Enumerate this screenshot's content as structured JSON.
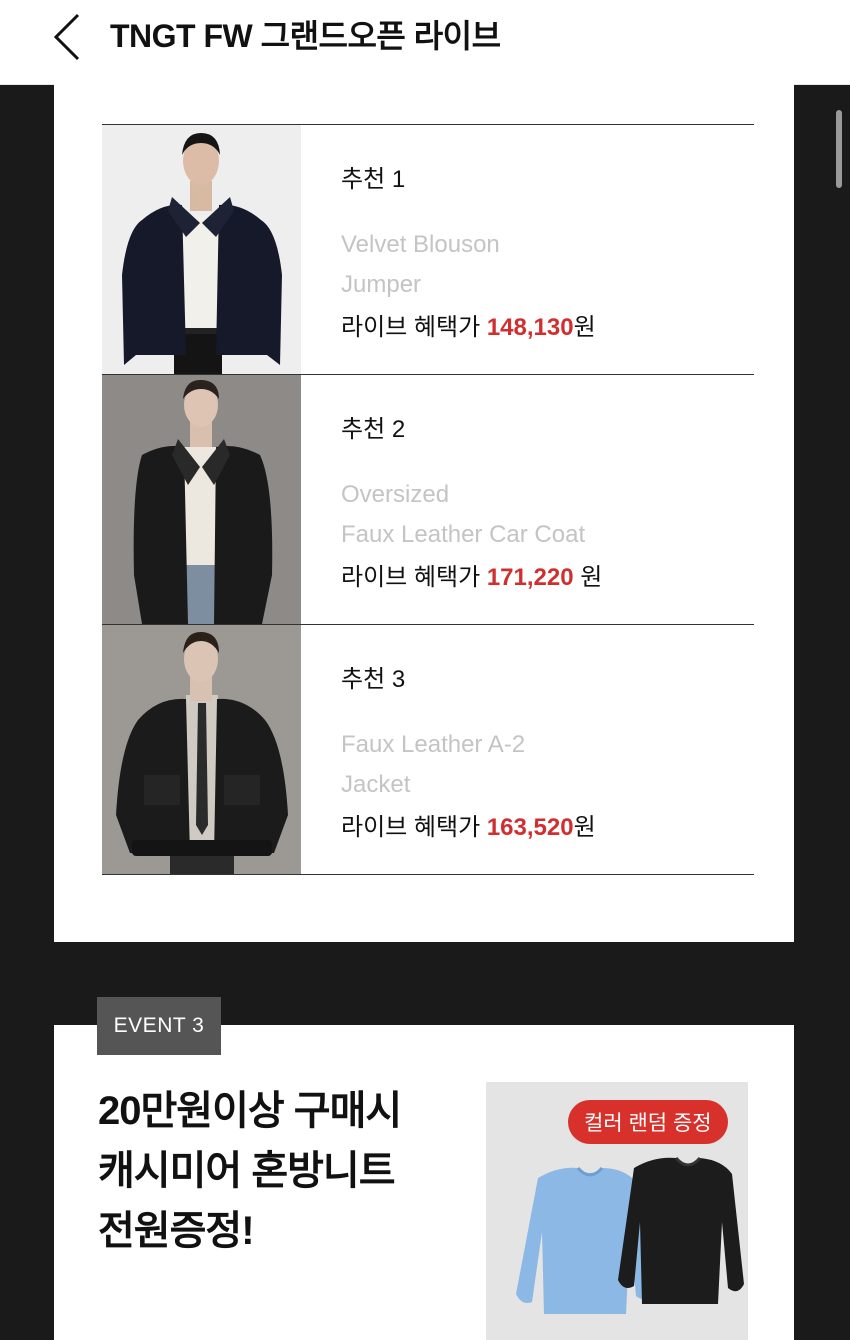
{
  "header": {
    "title": "TNGT FW 그랜드오픈 라이브"
  },
  "products": [
    {
      "label": "추천 1",
      "name_line1": "Velvet Blouson",
      "name_line2": "Jumper",
      "price_prefix": "라이브 혜택가 ",
      "price": "148,130",
      "price_unit": "원"
    },
    {
      "label": "추천 2",
      "name_line1": "Oversized",
      "name_line2": "Faux Leather Car Coat",
      "price_prefix": "라이브 혜택가 ",
      "price": "171,220",
      "price_unit": " 원"
    },
    {
      "label": "추천 3",
      "name_line1": "Faux Leather A-2",
      "name_line2": "Jacket",
      "price_prefix": "라이브 혜택가 ",
      "price": "163,520",
      "price_unit": "원"
    }
  ],
  "event": {
    "tag": "EVENT 3",
    "headline_line1": "20만원이상 구매시",
    "headline_line2": "캐시미어 혼방니트",
    "headline_line3": "전원증정!",
    "gift_badge": "컬러 랜덤 증정"
  },
  "colors": {
    "accent_red": "#d12f2f",
    "badge_red": "#d8302b",
    "page_bg": "#1a1a1a",
    "event_tag_bg": "#555555",
    "sweater_blue": "#8cb8e6",
    "sweater_black": "#1c1c1c"
  },
  "icons": {
    "back": "chevron-left-icon"
  }
}
